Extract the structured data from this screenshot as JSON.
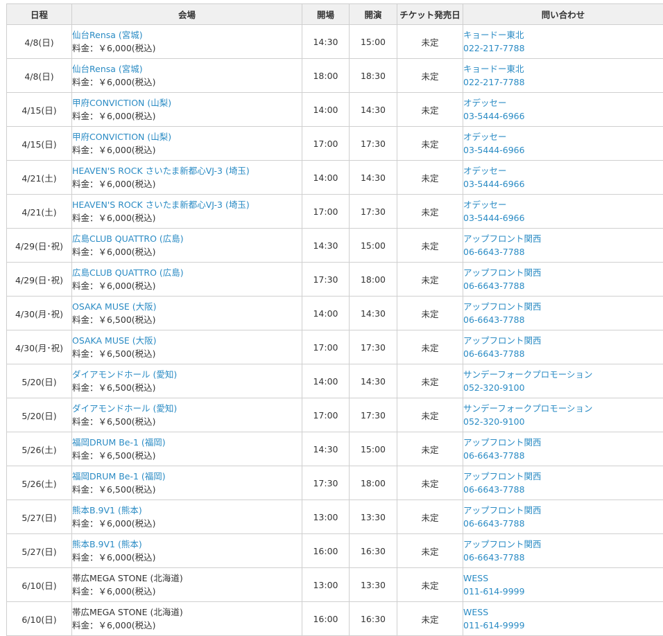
{
  "headers": {
    "date": "日程",
    "venue": "会場",
    "open": "開場",
    "start": "開演",
    "ticket": "チケット発売日",
    "contact": "問い合わせ"
  },
  "rows": [
    {
      "date": "4/8(日)",
      "venue": "仙台Rensa (宮城)",
      "venue_link": true,
      "price": "料金：￥6,000(税込)",
      "open": "14:30",
      "start": "15:00",
      "ticket": "未定",
      "org": "キョードー東北",
      "tel": "022-217-7788"
    },
    {
      "date": "4/8(日)",
      "venue": "仙台Rensa (宮城)",
      "venue_link": true,
      "price": "料金：￥6,000(税込)",
      "open": "18:00",
      "start": "18:30",
      "ticket": "未定",
      "org": "キョードー東北",
      "tel": "022-217-7788"
    },
    {
      "date": "4/15(日)",
      "venue": "甲府CONVICTION (山梨)",
      "venue_link": true,
      "price": "料金：￥6,000(税込)",
      "open": "14:00",
      "start": "14:30",
      "ticket": "未定",
      "org": "オデッセー",
      "tel": "03-5444-6966"
    },
    {
      "date": "4/15(日)",
      "venue": "甲府CONVICTION (山梨)",
      "venue_link": true,
      "price": "料金：￥6,000(税込)",
      "open": "17:00",
      "start": "17:30",
      "ticket": "未定",
      "org": "オデッセー",
      "tel": "03-5444-6966"
    },
    {
      "date": "4/21(土)",
      "venue": "HEAVEN'S ROCK さいたま新都心VJ-3 (埼玉)",
      "venue_link": true,
      "price": "料金：￥6,000(税込)",
      "open": "14:00",
      "start": "14:30",
      "ticket": "未定",
      "org": "オデッセー",
      "tel": "03-5444-6966"
    },
    {
      "date": "4/21(土)",
      "venue": "HEAVEN'S ROCK さいたま新都心VJ-3 (埼玉)",
      "venue_link": true,
      "price": "料金：￥6,000(税込)",
      "open": "17:00",
      "start": "17:30",
      "ticket": "未定",
      "org": "オデッセー",
      "tel": "03-5444-6966"
    },
    {
      "date": "4/29(日･祝)",
      "venue": "広島CLUB QUATTRO (広島)",
      "venue_link": true,
      "price": "料金：￥6,000(税込)",
      "open": "14:30",
      "start": "15:00",
      "ticket": "未定",
      "org": "アップフロント関西",
      "tel": "06-6643-7788"
    },
    {
      "date": "4/29(日･祝)",
      "venue": "広島CLUB QUATTRO (広島)",
      "venue_link": true,
      "price": "料金：￥6,000(税込)",
      "open": "17:30",
      "start": "18:00",
      "ticket": "未定",
      "org": "アップフロント関西",
      "tel": "06-6643-7788"
    },
    {
      "date": "4/30(月･祝)",
      "venue": "OSAKA MUSE (大阪)",
      "venue_link": true,
      "price": "料金：￥6,500(税込)",
      "open": "14:00",
      "start": "14:30",
      "ticket": "未定",
      "org": "アップフロント関西",
      "tel": "06-6643-7788"
    },
    {
      "date": "4/30(月･祝)",
      "venue": "OSAKA MUSE (大阪)",
      "venue_link": true,
      "price": "料金：￥6,500(税込)",
      "open": "17:00",
      "start": "17:30",
      "ticket": "未定",
      "org": "アップフロント関西",
      "tel": "06-6643-7788"
    },
    {
      "date": "5/20(日)",
      "venue": "ダイアモンドホール (愛知)",
      "venue_link": true,
      "price": "料金：￥6,500(税込)",
      "open": "14:00",
      "start": "14:30",
      "ticket": "未定",
      "org": "サンデーフォークプロモーション",
      "tel": "052-320-9100"
    },
    {
      "date": "5/20(日)",
      "venue": "ダイアモンドホール (愛知)",
      "venue_link": true,
      "price": "料金：￥6,500(税込)",
      "open": "17:00",
      "start": "17:30",
      "ticket": "未定",
      "org": "サンデーフォークプロモーション",
      "tel": "052-320-9100"
    },
    {
      "date": "5/26(土)",
      "venue": "福岡DRUM Be-1 (福岡)",
      "venue_link": true,
      "price": "料金：￥6,500(税込)",
      "open": "14:30",
      "start": "15:00",
      "ticket": "未定",
      "org": "アップフロント関西",
      "tel": "06-6643-7788"
    },
    {
      "date": "5/26(土)",
      "venue": "福岡DRUM Be-1 (福岡)",
      "venue_link": true,
      "price": "料金：￥6,500(税込)",
      "open": "17:30",
      "start": "18:00",
      "ticket": "未定",
      "org": "アップフロント関西",
      "tel": "06-6643-7788"
    },
    {
      "date": "5/27(日)",
      "venue": "熊本B.9V1 (熊本)",
      "venue_link": true,
      "price": "料金：￥6,000(税込)",
      "open": "13:00",
      "start": "13:30",
      "ticket": "未定",
      "org": "アップフロント関西",
      "tel": "06-6643-7788"
    },
    {
      "date": "5/27(日)",
      "venue": "熊本B.9V1 (熊本)",
      "venue_link": true,
      "price": "料金：￥6,000(税込)",
      "open": "16:00",
      "start": "16:30",
      "ticket": "未定",
      "org": "アップフロント関西",
      "tel": "06-6643-7788"
    },
    {
      "date": "6/10(日)",
      "venue": "帯広MEGA STONE (北海道)",
      "venue_link": false,
      "price": "料金：￥6,000(税込)",
      "open": "13:00",
      "start": "13:30",
      "ticket": "未定",
      "org": "WESS",
      "tel": "011-614-9999"
    },
    {
      "date": "6/10(日)",
      "venue": "帯広MEGA STONE (北海道)",
      "venue_link": false,
      "price": "料金：￥6,000(税込)",
      "open": "16:00",
      "start": "16:30",
      "ticket": "未定",
      "org": "WESS",
      "tel": "011-614-9999"
    }
  ],
  "colors": {
    "link": "#2a8bc4",
    "text": "#333333",
    "header_bg": "#f0f0f0",
    "border": "#cfcfcf"
  }
}
